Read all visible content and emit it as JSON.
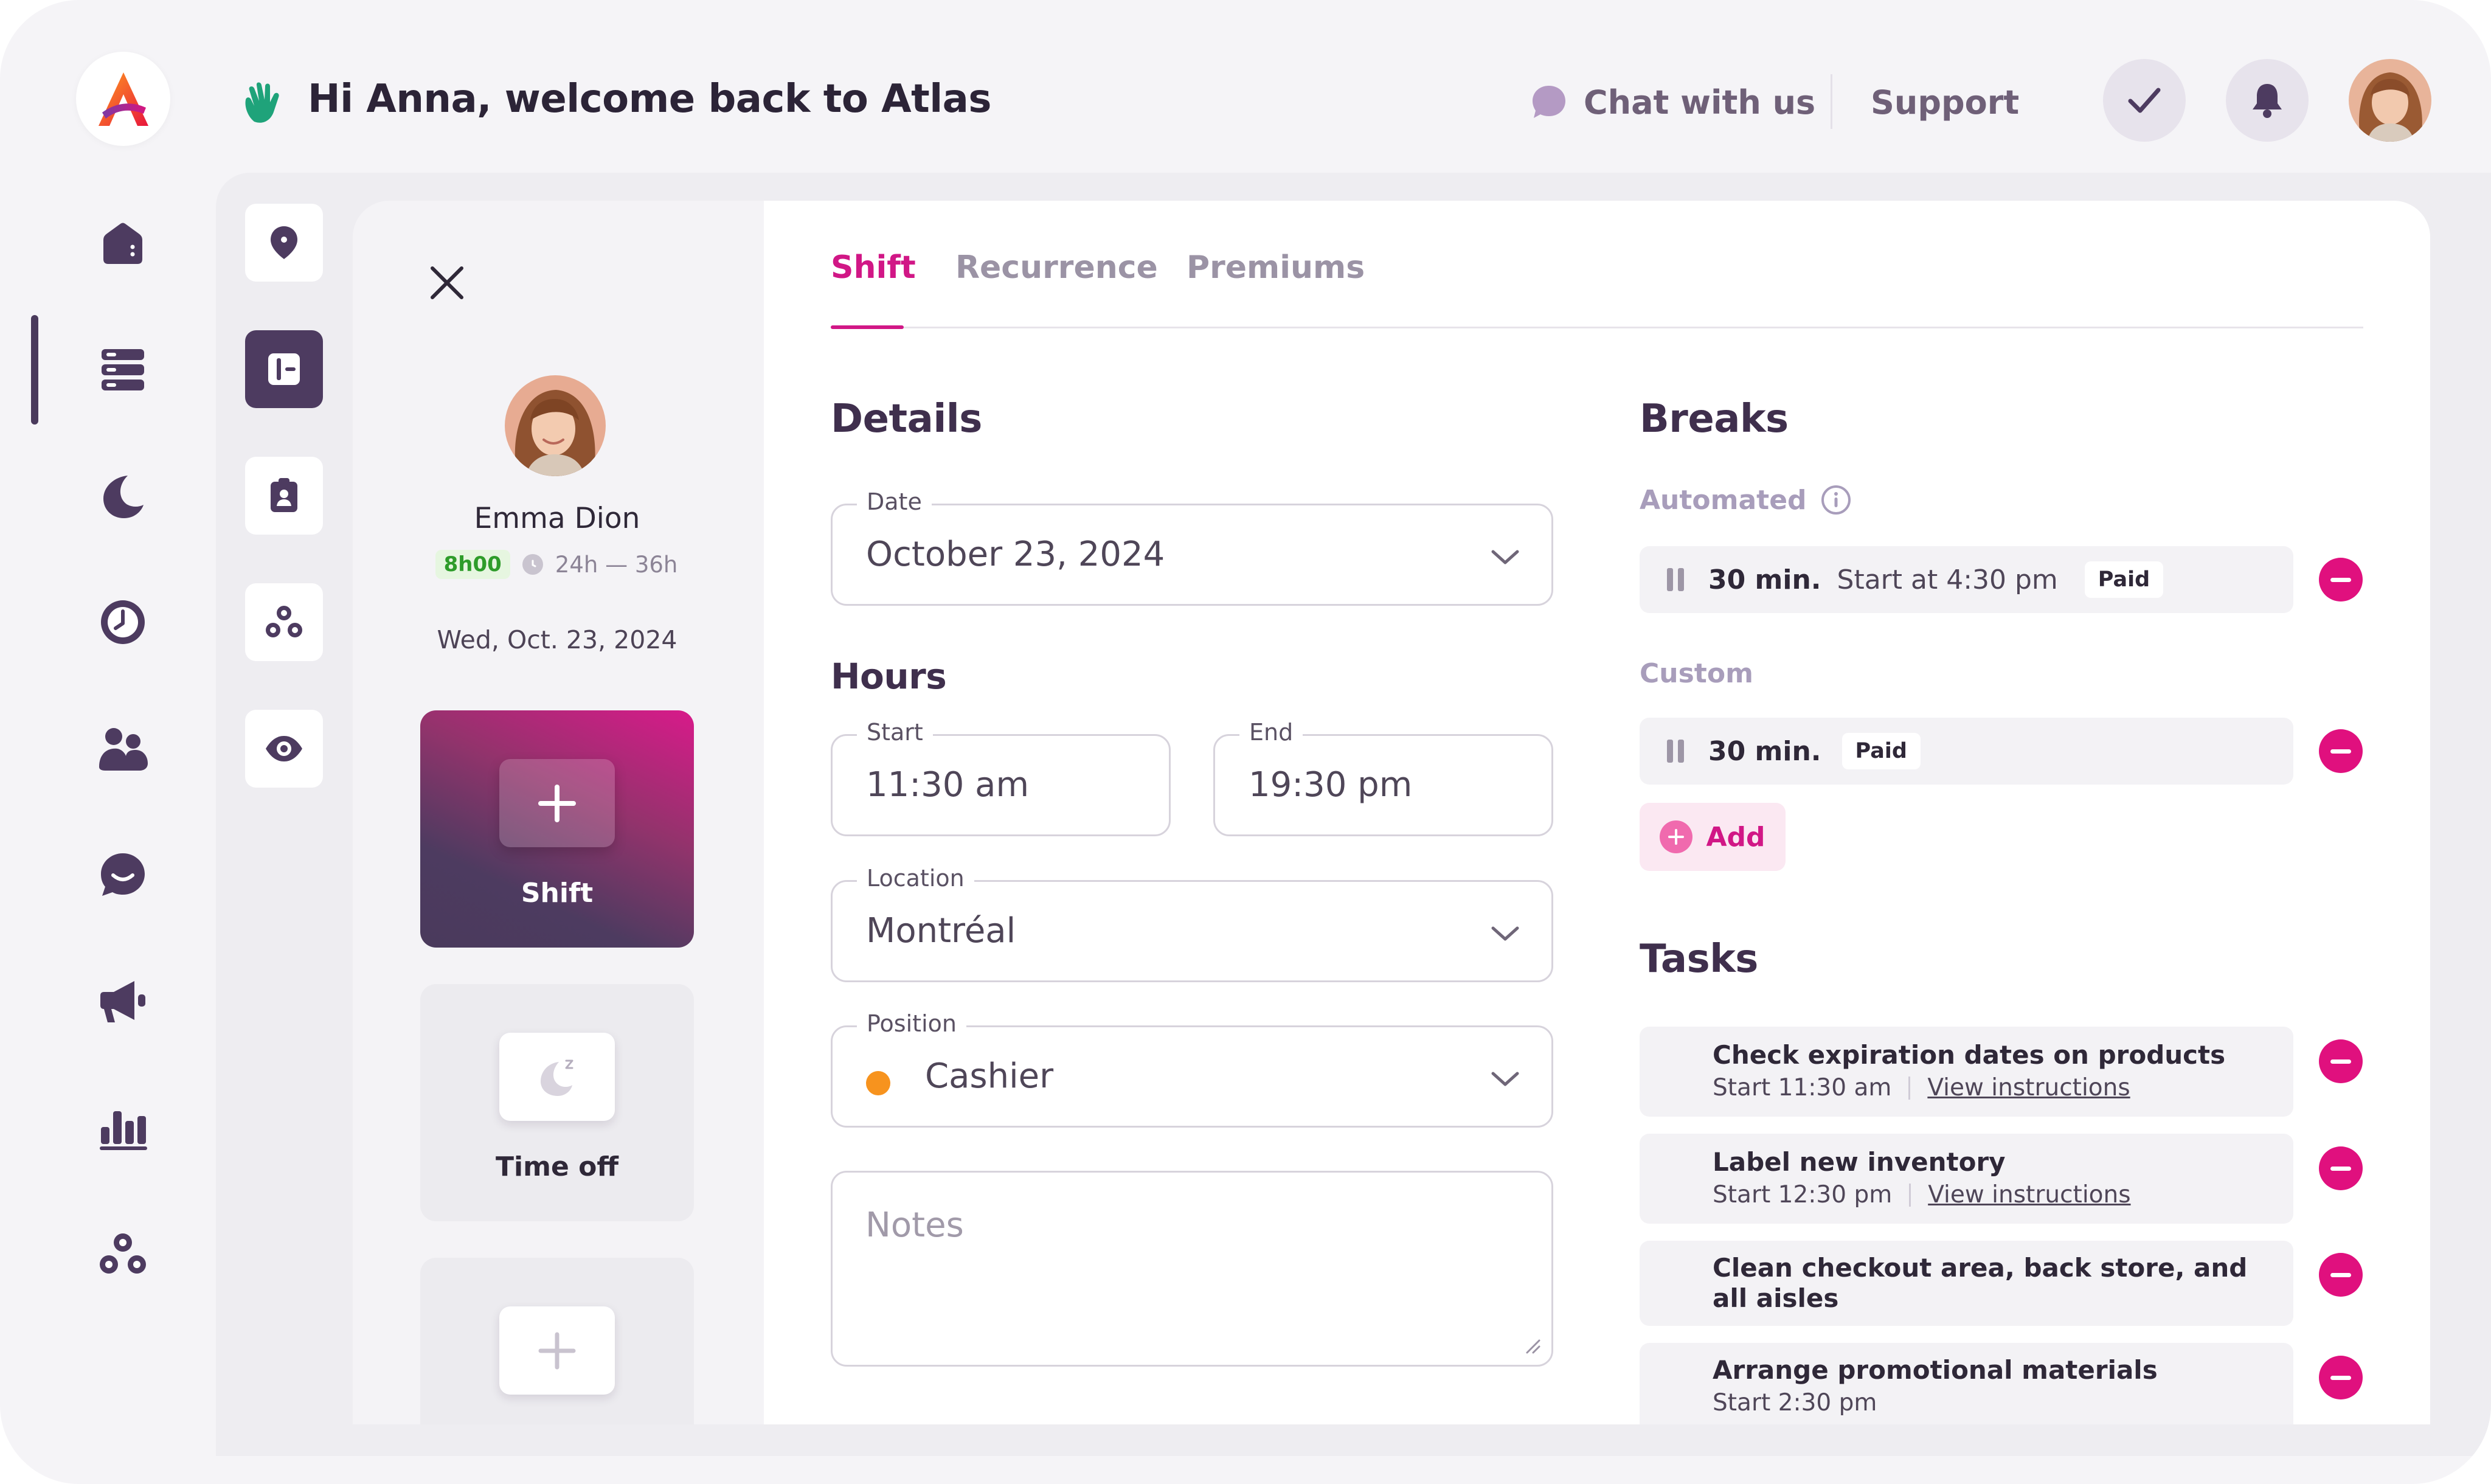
{
  "header": {
    "welcome": "Hi Anna, welcome back to Atlas",
    "chat_label": "Chat with us",
    "support_label": "Support"
  },
  "rail": {
    "items": [
      "home-icon",
      "schedule-icon",
      "moon-icon",
      "time-icon",
      "people-icon",
      "chat-icon",
      "megaphone-icon",
      "reports-icon",
      "groups-icon"
    ],
    "active": "schedule-icon"
  },
  "tools": [
    "location-icon",
    "layout-icon",
    "badge-icon",
    "groups-icon",
    "eye-icon"
  ],
  "employee": {
    "name": "Emma Dion",
    "hours_badge": "8h00",
    "hours_range": "24h — 36h",
    "date": "Wed, Oct. 23, 2024"
  },
  "shift_types": [
    {
      "label": "Shift",
      "icon": "plus-icon"
    },
    {
      "label": "Time off",
      "icon": "moon-icon"
    },
    {
      "label": "",
      "icon": "plus-icon"
    }
  ],
  "tabs": [
    {
      "label": "Shift"
    },
    {
      "label": "Recurrence"
    },
    {
      "label": "Premiums"
    }
  ],
  "details": {
    "title": "Details",
    "date_label": "Date",
    "date_value": "October 23, 2024",
    "hours_title": "Hours",
    "start_label": "Start",
    "start_value": "11:30 am",
    "end_label": "End",
    "end_value": "19:30 pm",
    "location_label": "Location",
    "location_value": "Montréal",
    "position_label": "Position",
    "position_value": "Cashier",
    "notes_placeholder": "Notes"
  },
  "breaks": {
    "title": "Breaks",
    "automated_label": "Automated",
    "automated": [
      {
        "duration": "30 min.",
        "start": "Start at 4:30 pm",
        "paid": "Paid"
      }
    ],
    "custom_label": "Custom",
    "custom": [
      {
        "duration": "30 min.",
        "paid": "Paid"
      }
    ],
    "add_label": "Add"
  },
  "tasks": {
    "title": "Tasks",
    "items": [
      {
        "title": "Check expiration dates on products",
        "start": "Start 11:30 am",
        "link": "View instructions"
      },
      {
        "title": "Label new inventory",
        "start": "Start 12:30 pm",
        "link": "View instructions"
      },
      {
        "title": "Clean checkout area, back store, and all aisles"
      },
      {
        "title": "Arrange promotional materials",
        "start": "Start 2:30 pm"
      }
    ]
  },
  "colors": {
    "accent": "#d11786",
    "dark": "#4d3b60",
    "position_dot": "#f7931e",
    "hours_badge": "#2e9c2a"
  }
}
